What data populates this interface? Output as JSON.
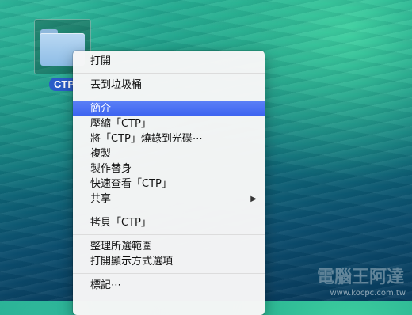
{
  "desktop": {
    "folder_label": "CTP"
  },
  "context_menu": {
    "groups": [
      [
        "打開"
      ],
      [
        "丟到垃圾桶"
      ],
      [
        "簡介",
        "壓縮「CTP」",
        "將「CTP」燒錄到光碟⋯",
        "複製",
        "製作替身",
        "快速查看「CTP」",
        "共享"
      ],
      [
        "拷貝「CTP」"
      ],
      [
        "整理所選範圍",
        "打開顯示方式選項"
      ],
      [
        "標記⋯"
      ]
    ],
    "highlighted": "簡介",
    "submenu_item": "共享",
    "submenu_arrow": "▶"
  },
  "watermark": {
    "text": "電腦王阿達",
    "url": "www.kocpc.com.tw"
  }
}
